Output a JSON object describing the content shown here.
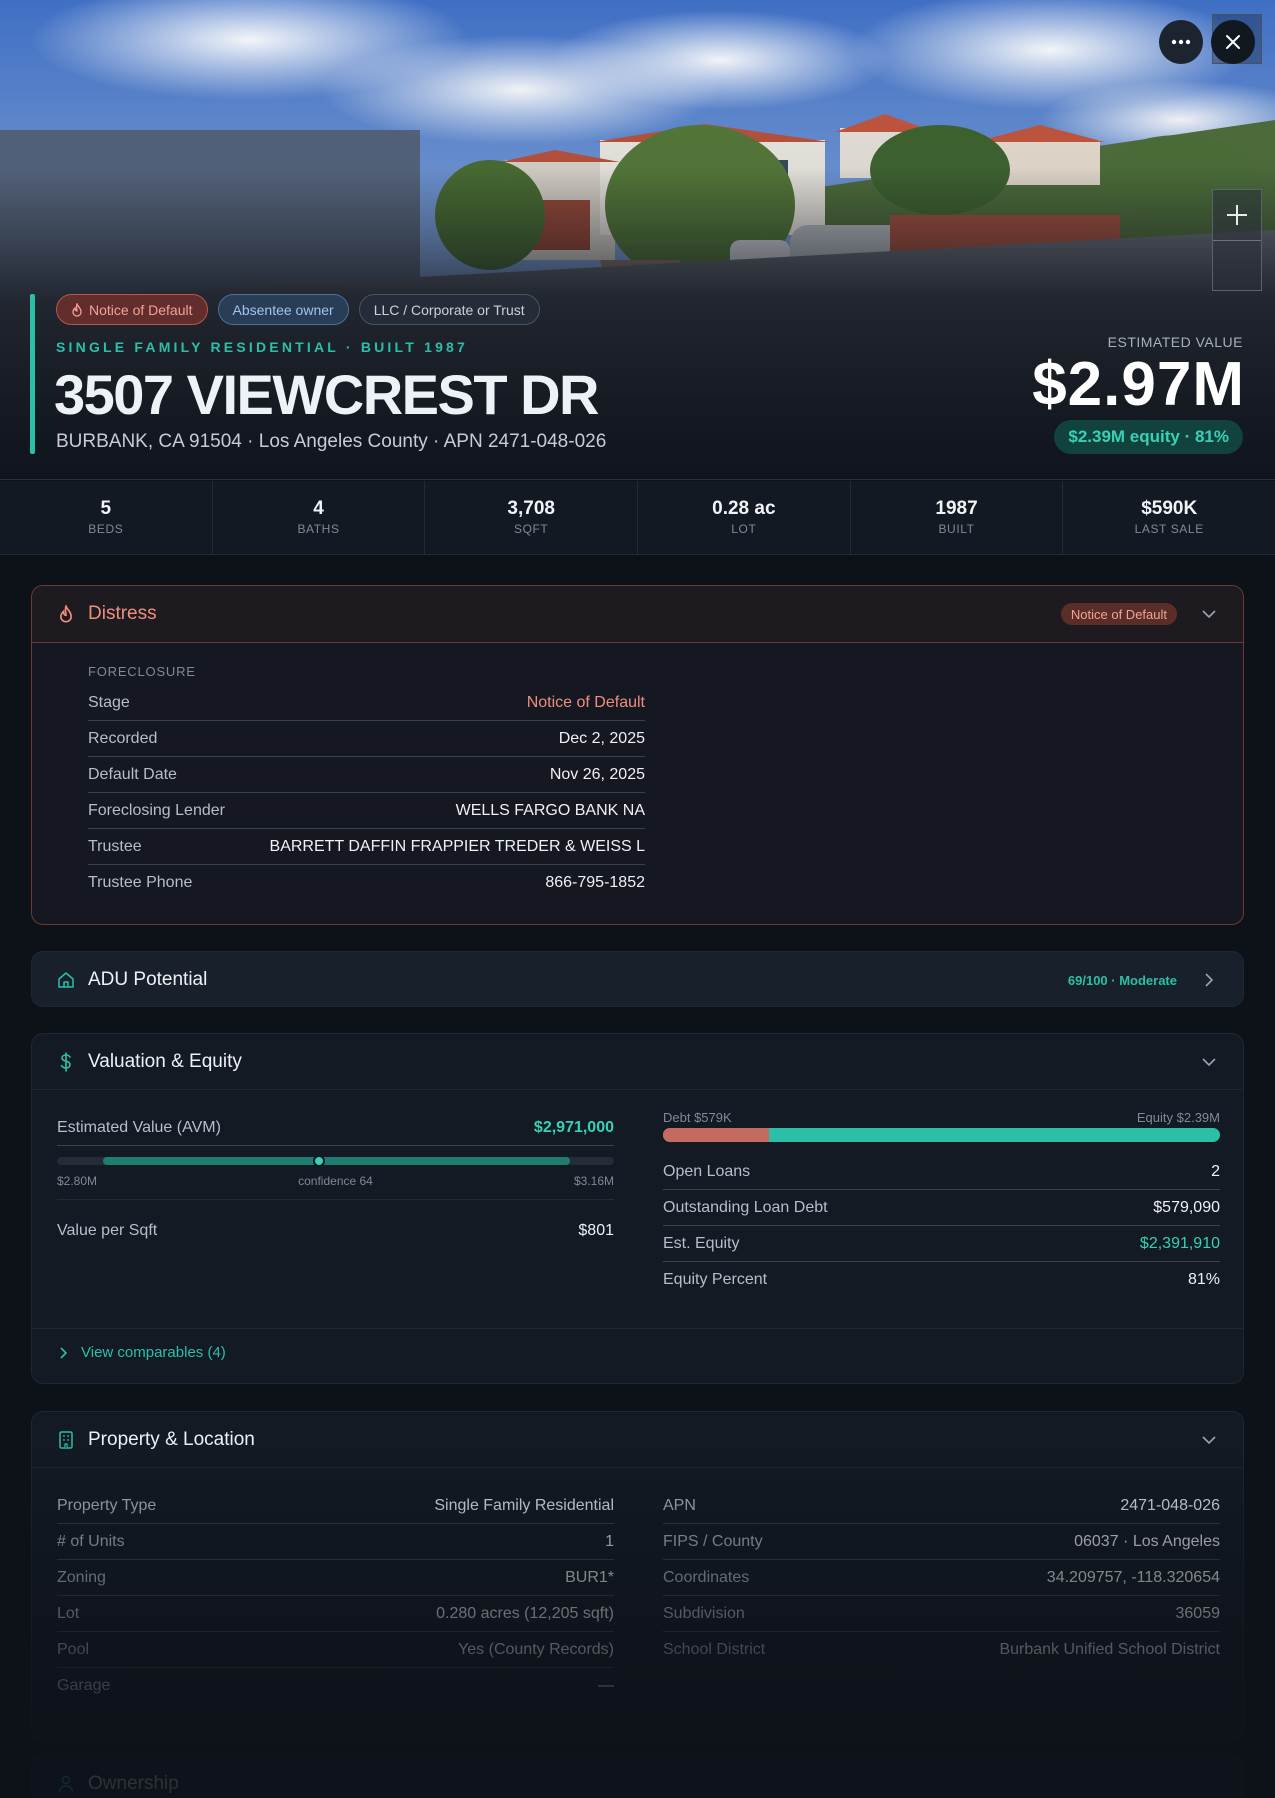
{
  "hero": {
    "chips": [
      {
        "label": "Notice of Default",
        "icon": "flame-icon"
      },
      {
        "label": "Absentee owner"
      },
      {
        "label": "LLC / Corporate or Trust"
      }
    ],
    "kicker": "SINGLE FAMILY RESIDENTIAL · BUILT 1987",
    "address": "3507 VIEWCREST DR",
    "subaddress": "BURBANK, CA 91504 · Los Angeles County · APN 2471-048-026",
    "estimated_label": "ESTIMATED VALUE",
    "estimated_value": "$2.97M",
    "equity_pill": "$2.39M equity · 81%"
  },
  "stats": [
    {
      "value": "5",
      "label": "BEDS"
    },
    {
      "value": "4",
      "label": "BATHS"
    },
    {
      "value": "3,708",
      "label": "SQFT"
    },
    {
      "value": "0.28 ac",
      "label": "LOT"
    },
    {
      "value": "1987",
      "label": "BUILT"
    },
    {
      "value": "$590K",
      "label": "LAST SALE"
    }
  ],
  "distress": {
    "title": "Distress",
    "badge": "Notice of Default",
    "section_label": "FORECLOSURE",
    "rows": [
      {
        "k": "Stage",
        "v": "Notice of Default"
      },
      {
        "k": "Recorded",
        "v": "Dec 2, 2025"
      },
      {
        "k": "Default Date",
        "v": "Nov 26, 2025"
      },
      {
        "k": "Foreclosing Lender",
        "v": "WELLS FARGO BANK NA"
      },
      {
        "k": "Trustee",
        "v": "BARRETT DAFFIN FRAPPIER TREDER & WEISS L"
      },
      {
        "k": "Trustee Phone",
        "v": "866-795-1852"
      }
    ]
  },
  "adu": {
    "title": "ADU Potential",
    "score": "69/100 · Moderate"
  },
  "valuation": {
    "title": "Valuation & Equity",
    "avm_label": "Estimated Value (AVM)",
    "avm_value": "$2,971,000",
    "range_low": "$2.80M",
    "range_high": "$3.16M",
    "confidence": "confidence 64",
    "range_marker_fraction": 0.47,
    "value_per_sqft_label": "Value per Sqft",
    "value_per_sqft": "$801",
    "debt_label": "Debt $579K",
    "equity_label": "Equity $2.39M",
    "debt_fraction": 0.19,
    "rows": [
      {
        "k": "Open Loans",
        "v": "2"
      },
      {
        "k": "Outstanding Loan Debt",
        "v": "$579,090"
      },
      {
        "k": "Est. Equity",
        "v": "$2,391,910"
      },
      {
        "k": "Equity Percent",
        "v": "81%"
      }
    ],
    "comparables_link": "View comparables (4)"
  },
  "property": {
    "title": "Property & Location",
    "left_rows": [
      {
        "k": "Property Type",
        "v": "Single Family Residential"
      },
      {
        "k": "# of Units",
        "v": "1"
      },
      {
        "k": "Zoning",
        "v": "BUR1*"
      },
      {
        "k": "Lot",
        "v": "0.280 acres (12,205 sqft)"
      },
      {
        "k": "Pool",
        "v": "Yes (County Records)"
      },
      {
        "k": "Garage",
        "v": "—"
      }
    ],
    "right_rows": [
      {
        "k": "APN",
        "v": "2471-048-026"
      },
      {
        "k": "FIPS / County",
        "v": "06037 · Los Angeles"
      },
      {
        "k": "Coordinates",
        "v": "34.209757, -118.320654"
      },
      {
        "k": "Subdivision",
        "v": "36059"
      },
      {
        "k": "School District",
        "v": "Burbank Unified School District"
      }
    ]
  },
  "ownership": {
    "title": "Ownership"
  },
  "colors": {
    "accent": "#2bbfa8",
    "distress": "#ef8d7e",
    "debt": "#c46a5f",
    "background": "#0d1118"
  }
}
